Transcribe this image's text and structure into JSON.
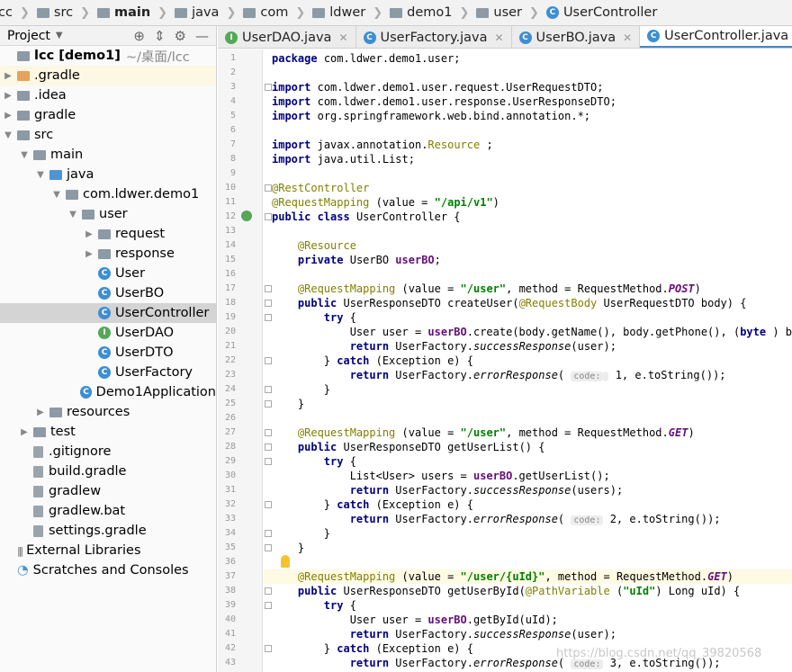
{
  "breadcrumbs": [
    {
      "label": "lcc",
      "icon": "folder-icon",
      "bold": false
    },
    {
      "label": "src",
      "icon": "folder-icon",
      "bold": false
    },
    {
      "label": "main",
      "icon": "folder-icon",
      "bold": true
    },
    {
      "label": "java",
      "icon": "folder-icon",
      "bold": false
    },
    {
      "label": "com",
      "icon": "package-icon",
      "bold": false
    },
    {
      "label": "ldwer",
      "icon": "package-icon",
      "bold": false
    },
    {
      "label": "demo1",
      "icon": "package-icon",
      "bold": false
    },
    {
      "label": "user",
      "icon": "package-icon",
      "bold": false
    },
    {
      "label": "UserController",
      "icon": "class-icon",
      "bold": false
    }
  ],
  "project": {
    "title": "Project"
  },
  "tree": [
    {
      "depth": 0,
      "arrow": "",
      "icon": "folder",
      "label": "lcc [demo1]",
      "extra": "~/桌面/lcc",
      "bold": true
    },
    {
      "depth": 0,
      "arrow": "▶",
      "icon": "folder-orange",
      "label": ".gradle",
      "hl": true
    },
    {
      "depth": 0,
      "arrow": "▶",
      "icon": "folder",
      "label": ".idea"
    },
    {
      "depth": 0,
      "arrow": "▶",
      "icon": "folder",
      "label": "gradle"
    },
    {
      "depth": 0,
      "arrow": "▼",
      "icon": "folder",
      "label": "src"
    },
    {
      "depth": 1,
      "arrow": "▼",
      "icon": "folder",
      "label": "main"
    },
    {
      "depth": 2,
      "arrow": "▼",
      "icon": "folder-blue",
      "label": "java"
    },
    {
      "depth": 3,
      "arrow": "▼",
      "icon": "package",
      "label": "com.ldwer.demo1"
    },
    {
      "depth": 4,
      "arrow": "▼",
      "icon": "package",
      "label": "user"
    },
    {
      "depth": 5,
      "arrow": "▶",
      "icon": "package",
      "label": "request"
    },
    {
      "depth": 5,
      "arrow": "▶",
      "icon": "package",
      "label": "response"
    },
    {
      "depth": 5,
      "arrow": "",
      "icon": "class",
      "label": "User"
    },
    {
      "depth": 5,
      "arrow": "",
      "icon": "class",
      "label": "UserBO"
    },
    {
      "depth": 5,
      "arrow": "",
      "icon": "class",
      "label": "UserController",
      "sel": true
    },
    {
      "depth": 5,
      "arrow": "",
      "icon": "interface",
      "label": "UserDAO"
    },
    {
      "depth": 5,
      "arrow": "",
      "icon": "class",
      "label": "UserDTO"
    },
    {
      "depth": 5,
      "arrow": "",
      "icon": "class",
      "label": "UserFactory"
    },
    {
      "depth": 4,
      "arrow": "",
      "icon": "class",
      "label": "Demo1Application"
    },
    {
      "depth": 2,
      "arrow": "▶",
      "icon": "folder",
      "label": "resources"
    },
    {
      "depth": 1,
      "arrow": "▶",
      "icon": "folder",
      "label": "test"
    },
    {
      "depth": 1,
      "arrow": "",
      "icon": "file",
      "label": ".gitignore"
    },
    {
      "depth": 1,
      "arrow": "",
      "icon": "file",
      "label": "build.gradle"
    },
    {
      "depth": 1,
      "arrow": "",
      "icon": "file",
      "label": "gradlew"
    },
    {
      "depth": 1,
      "arrow": "",
      "icon": "file",
      "label": "gradlew.bat"
    },
    {
      "depth": 1,
      "arrow": "",
      "icon": "file",
      "label": "settings.gradle"
    },
    {
      "depth": 0,
      "arrow": "",
      "icon": "lib",
      "label": "External Libraries"
    },
    {
      "depth": 0,
      "arrow": "",
      "icon": "scratch",
      "label": "Scratches and Consoles"
    }
  ],
  "tabs": [
    {
      "label": "UserDAO.java",
      "icon": "interface",
      "active": false
    },
    {
      "label": "UserFactory.java",
      "icon": "class",
      "active": false
    },
    {
      "label": "UserBO.java",
      "icon": "class",
      "active": false
    },
    {
      "label": "UserController.java",
      "icon": "class",
      "active": true
    }
  ],
  "code": [
    [
      [
        "kw",
        "package"
      ],
      [
        "",
        "com.ldwer.demo1.user;"
      ]
    ],
    [],
    [
      [
        "kw",
        "import"
      ],
      [
        "",
        "com.ldwer.demo1.user.request.UserRequestDTO;"
      ]
    ],
    [
      [
        "kw",
        "import"
      ],
      [
        "",
        "com.ldwer.demo1.user.response.UserResponseDTO;"
      ]
    ],
    [
      [
        "kw",
        "import"
      ],
      [
        "",
        "org.springframework.web.bind.annotation.*;"
      ]
    ],
    [],
    [
      [
        "kw",
        "import"
      ],
      [
        "",
        "javax.annotation."
      ],
      [
        "an",
        "Resource"
      ],
      [
        "",
        ";"
      ]
    ],
    [
      [
        "kw",
        "import"
      ],
      [
        "",
        "java.util.List;"
      ]
    ],
    [],
    [
      [
        "an",
        "@RestController"
      ]
    ],
    [
      [
        "an",
        "@RequestMapping"
      ],
      [
        "",
        "(value = "
      ],
      [
        "st",
        "\"/api/v1\""
      ],
      [
        "",
        ")"
      ]
    ],
    [
      [
        "kw",
        "public class"
      ],
      [
        "",
        "UserController {"
      ]
    ],
    [],
    [
      [
        "",
        "    "
      ],
      [
        "an",
        "@Resource"
      ]
    ],
    [
      [
        "",
        "    "
      ],
      [
        "kw",
        "private"
      ],
      [
        "",
        "UserBO "
      ],
      [
        "fd",
        "userBO"
      ],
      [
        "",
        ";"
      ]
    ],
    [],
    [
      [
        "",
        "    "
      ],
      [
        "an",
        "@RequestMapping"
      ],
      [
        "",
        "(value = "
      ],
      [
        "st",
        "\"/user\""
      ],
      [
        "",
        ", method = RequestMethod."
      ],
      [
        "fd it",
        "POST"
      ],
      [
        "",
        ")"
      ]
    ],
    [
      [
        "",
        "    "
      ],
      [
        "kw",
        "public"
      ],
      [
        "",
        "UserResponseDTO createUser("
      ],
      [
        "an",
        "@RequestBody"
      ],
      [
        "",
        "UserRequestDTO body) {"
      ]
    ],
    [
      [
        "",
        "        "
      ],
      [
        "kw",
        "try"
      ],
      [
        "",
        "{"
      ]
    ],
    [
      [
        "",
        "            User user = "
      ],
      [
        "fd",
        "userBO"
      ],
      [
        "",
        ".create(body.getName(), body.getPhone(), ("
      ],
      [
        "kw",
        "byte"
      ],
      [
        "",
        ") body."
      ]
    ],
    [
      [
        "",
        "            "
      ],
      [
        "kw",
        "return"
      ],
      [
        "",
        "UserFactory."
      ],
      [
        "it",
        "successResponse"
      ],
      [
        "",
        "(user);"
      ]
    ],
    [
      [
        "",
        "        } "
      ],
      [
        "kw",
        "catch"
      ],
      [
        "",
        "(Exception e) {"
      ]
    ],
    [
      [
        "",
        "            "
      ],
      [
        "kw",
        "return"
      ],
      [
        "",
        "UserFactory."
      ],
      [
        "it",
        "errorResponse"
      ],
      [
        "",
        "( "
      ],
      [
        "hint",
        "code:"
      ],
      [
        "",
        "",
        " 1, e.toString());"
      ]
    ],
    [
      [
        "",
        "        }"
      ]
    ],
    [
      [
        "",
        "    }"
      ]
    ],
    [],
    [
      [
        "",
        "    "
      ],
      [
        "an",
        "@RequestMapping"
      ],
      [
        "",
        "(value = "
      ],
      [
        "st",
        "\"/user\""
      ],
      [
        "",
        ", method = RequestMethod."
      ],
      [
        "fd it",
        "GET"
      ],
      [
        "",
        ")"
      ]
    ],
    [
      [
        "",
        "    "
      ],
      [
        "kw",
        "public"
      ],
      [
        "",
        "UserResponseDTO getUserList() {"
      ]
    ],
    [
      [
        "",
        "        "
      ],
      [
        "kw",
        "try"
      ],
      [
        "",
        "{"
      ]
    ],
    [
      [
        "",
        "            List<User> users = "
      ],
      [
        "fd",
        "userBO"
      ],
      [
        "",
        ".getUserList();"
      ]
    ],
    [
      [
        "",
        "            "
      ],
      [
        "kw",
        "return"
      ],
      [
        "",
        "UserFactory."
      ],
      [
        "it",
        "successResponse"
      ],
      [
        "",
        "(users);"
      ]
    ],
    [
      [
        "",
        "        } "
      ],
      [
        "kw",
        "catch"
      ],
      [
        "",
        "(Exception e) {"
      ]
    ],
    [
      [
        "",
        "            "
      ],
      [
        "kw",
        "return"
      ],
      [
        "",
        "UserFactory."
      ],
      [
        "it",
        "errorResponse"
      ],
      [
        "",
        "( "
      ],
      [
        "hint",
        "code:"
      ],
      [
        "",
        " 2, e.toString());"
      ]
    ],
    [
      [
        "",
        "        }"
      ]
    ],
    [
      [
        "",
        "    }"
      ]
    ],
    [],
    [
      [
        "",
        "    "
      ],
      [
        "an",
        "@RequestMapping"
      ],
      [
        "",
        "(value = "
      ],
      [
        "st",
        "\"/user/{uId}\""
      ],
      [
        "",
        ", method = RequestMethod."
      ],
      [
        "fd it",
        "GET"
      ],
      [
        "",
        ")"
      ]
    ],
    [
      [
        "",
        "    "
      ],
      [
        "kw",
        "public"
      ],
      [
        "",
        "UserResponseDTO getUserById("
      ],
      [
        "an",
        "@PathVariable"
      ],
      [
        "",
        "("
      ],
      [
        "st",
        "\"uId\""
      ],
      [
        "",
        ") Long uId) {"
      ]
    ],
    [
      [
        "",
        "        "
      ],
      [
        "kw",
        "try"
      ],
      [
        "",
        "{"
      ]
    ],
    [
      [
        "",
        "            User user = "
      ],
      [
        "fd",
        "userBO"
      ],
      [
        "",
        ".getById(uId);"
      ]
    ],
    [
      [
        "",
        "            "
      ],
      [
        "kw",
        "return"
      ],
      [
        "",
        "UserFactory."
      ],
      [
        "it",
        "successResponse"
      ],
      [
        "",
        "(user);"
      ]
    ],
    [
      [
        "",
        "        } "
      ],
      [
        "kw",
        "catch"
      ],
      [
        "",
        "(Exception e) {"
      ]
    ],
    [
      [
        "",
        "            "
      ],
      [
        "kw",
        "return"
      ],
      [
        "",
        "UserFactory."
      ],
      [
        "it",
        "errorResponse"
      ],
      [
        "",
        "( "
      ],
      [
        "hint",
        "code:"
      ],
      [
        "",
        " 3, e.toString());"
      ]
    ]
  ],
  "current_line": 37,
  "watermark": "https://blog.csdn.net/qq_39820568"
}
